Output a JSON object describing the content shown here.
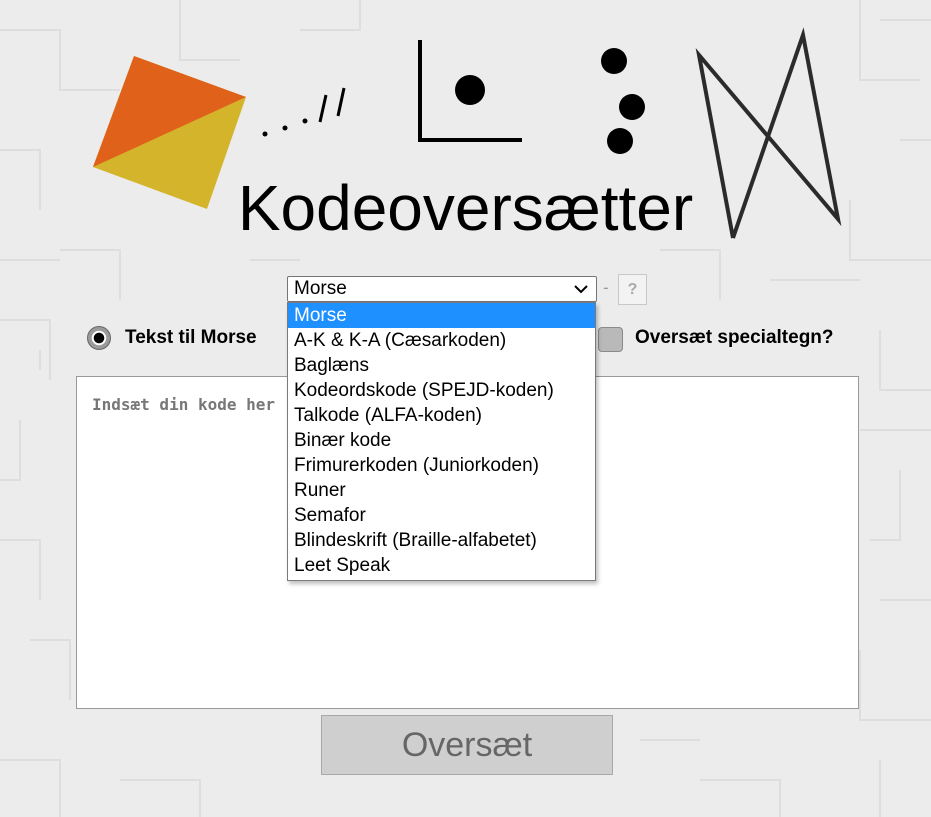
{
  "title": "Kodeoversætter",
  "logo": {
    "morse_glyphs": ". . . / /"
  },
  "select": {
    "value": "Morse",
    "options": [
      "Morse",
      "A-K & K-A (Cæsarkoden)",
      "Baglæns",
      "Kodeordskode (SPEJD-koden)",
      "Talkode (ALFA-koden)",
      "Binær kode",
      "Frimurerkoden (Juniorkoden)",
      "Runer",
      "Semafor",
      "Blindeskrift (Braille-alfabetet)",
      "Leet Speak"
    ],
    "selected_index": 0
  },
  "separator": "-",
  "help_label": "?",
  "direction_radio_label": "Tekst til Morse",
  "special_chars_label": "Oversæt specialtegn?",
  "input": {
    "placeholder": "Indsæt din kode her"
  },
  "translate_button": "Oversæt",
  "colors": {
    "accent_selected": "#1e90ff",
    "logo_orange": "#e0621a",
    "logo_yellow": "#d4b42a",
    "background": "#ececec"
  }
}
